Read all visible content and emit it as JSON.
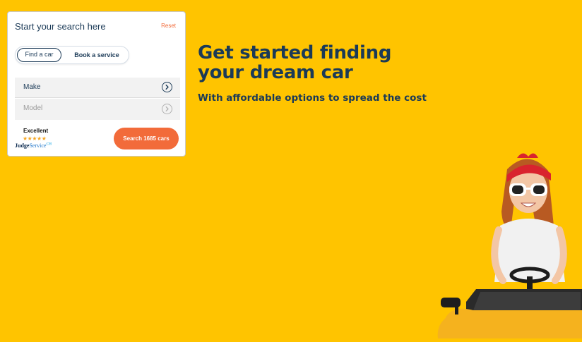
{
  "search_card": {
    "title": "Start your search here",
    "reset_label": "Reset",
    "tabs": [
      {
        "label": "Find a car",
        "active": true
      },
      {
        "label": "Book a service",
        "active": false
      }
    ],
    "make": {
      "label": "Make"
    },
    "model": {
      "label": "Model",
      "disabled": true
    },
    "rating": {
      "word": "Excellent",
      "stars": "★★★★★",
      "star_count": 5,
      "brand_part1": "Judge",
      "brand_part2": "Service",
      "brand_suffix": "CH"
    },
    "search_button": "Search 1685 cars"
  },
  "hero": {
    "title_line1": "Get started finding",
    "title_line2": "your dream car",
    "subtitle": "With affordable options to spread the cost",
    "image_icon": "girl-in-toy-car-illustration"
  },
  "colors": {
    "background": "#ffc400",
    "accent": "#f26b3a",
    "navy": "#1b3a57"
  }
}
